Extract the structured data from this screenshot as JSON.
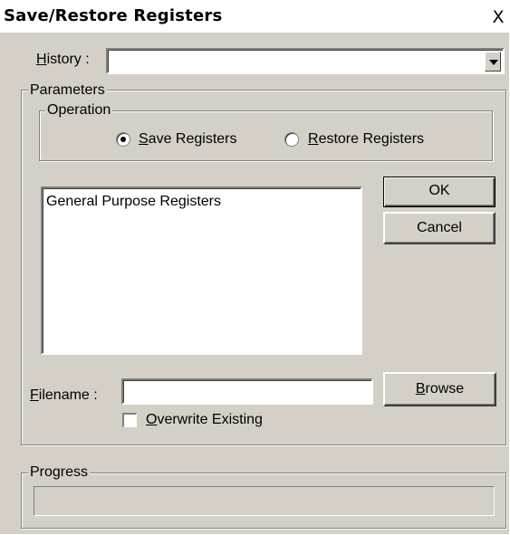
{
  "window": {
    "title": "Save/Restore Registers",
    "close_glyph": "X"
  },
  "history": {
    "label_u": "H",
    "label_rest": "istory :",
    "value": ""
  },
  "parameters": {
    "legend": "Parameters",
    "operation": {
      "legend": "Operation",
      "save": {
        "label_u": "S",
        "label_rest": "ave Registers",
        "selected": true
      },
      "restore": {
        "label_u": "R",
        "label_rest": "estore Registers",
        "selected": false
      }
    },
    "register_list": [
      "General Purpose Registers"
    ],
    "ok_label": "OK",
    "cancel_label": "Cancel",
    "filename": {
      "label_u": "F",
      "label_rest": "ilename :",
      "value": ""
    },
    "browse": {
      "label_u": "B",
      "label_rest": "rowse"
    },
    "overwrite": {
      "label_u": "O",
      "label_rest": "verwrite Existing",
      "checked": false
    }
  },
  "progress": {
    "legend": "Progress",
    "value": 0
  }
}
